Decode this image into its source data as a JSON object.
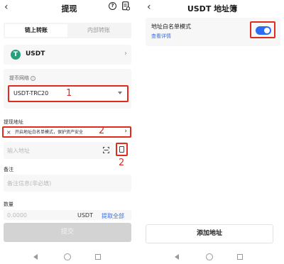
{
  "left": {
    "title": "提现",
    "tabs": [
      {
        "label": "链上转账",
        "active": true
      },
      {
        "label": "内部转账",
        "active": false
      }
    ],
    "coin": {
      "name": "USDT",
      "icon": "tether-icon",
      "color": "#26a17b"
    },
    "network": {
      "label": "提币网络",
      "value": "USDT-TRC20",
      "annotation": "1"
    },
    "address": {
      "label": "提现地址",
      "warning": "开启地址白名单模式，保护资产安全",
      "warning_annotation": "2",
      "placeholder": "输入地址",
      "book_annotation": "2"
    },
    "memo": {
      "label": "备注",
      "placeholder": "备注信息(非必填)"
    },
    "amount": {
      "label": "数量",
      "placeholder": "0.0000",
      "unit": "USDT",
      "all": "提取全部"
    },
    "submit": "提交"
  },
  "right": {
    "title": "USDT 地址簿",
    "whitelist": {
      "title": "地址白名单模式",
      "link": "查看详情",
      "enabled": true
    },
    "add_button": "添加地址"
  },
  "colors": {
    "accent": "#2a6df4",
    "annotation": "#e02b1d",
    "link": "#3a6fdc"
  }
}
